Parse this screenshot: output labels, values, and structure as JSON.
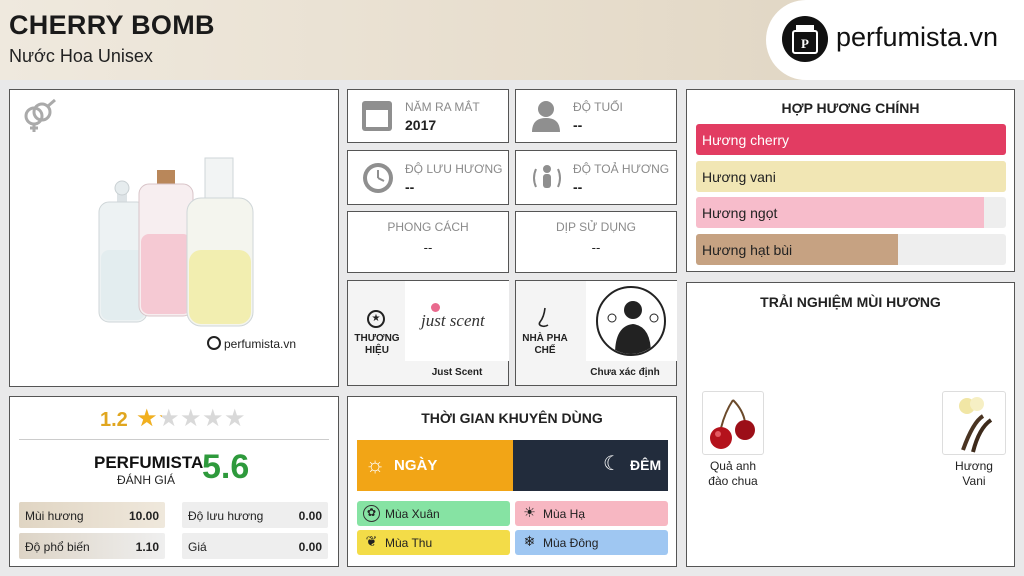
{
  "header": {
    "title": "CHERRY BOMB",
    "subtitle": "Nước Hoa Unisex",
    "logo_text": "perfumista.vn"
  },
  "image_card": {
    "watermark": "perfumista.vn"
  },
  "info": {
    "year_label": "NĂM RA MẮT",
    "year_value": "2017",
    "age_label": "ĐỘ TUỔI",
    "age_value": "--",
    "longevity_label": "ĐỘ LƯU HƯƠNG",
    "longevity_value": "--",
    "sillage_label": "ĐỘ TOẢ HƯƠNG",
    "sillage_value": "--",
    "style_label": "PHONG CÁCH",
    "style_value": "--",
    "occasion_label": "DỊP SỬ DỤNG",
    "occasion_value": "--",
    "brand_label": "THƯƠNG HIỆU",
    "brand_logo_text": "just scent",
    "brand_name": "Just Scent",
    "perfumer_label": "NHÀ PHA CHẾ",
    "perfumer_name": "Chưa xác định"
  },
  "accords": {
    "title": "HỢP HƯƠNG CHÍNH",
    "items": [
      {
        "label": "Hương cherry",
        "level": 1.0,
        "color": "#e23c62",
        "text_color": "#ffffff"
      },
      {
        "label": "Hương vani",
        "level": 1.0,
        "color": "#f1e6b4",
        "text_color": "#222222"
      },
      {
        "label": "Hương ngọt",
        "level": 0.93,
        "color": "#f7bccb",
        "text_color": "#222222"
      },
      {
        "label": "Hương hạt bùi",
        "level": 0.65,
        "color": "#c6a282",
        "text_color": "#222222"
      }
    ]
  },
  "rating": {
    "score": "1.2",
    "stars_filled": 1.2,
    "stars_total": 5,
    "perfumista_label": "PERFUMISTA",
    "perfumista_sub": "ĐÁNH GIÁ",
    "perfumista_score": "5.6",
    "stats": [
      {
        "label": "Mùi hương",
        "value": "10.00"
      },
      {
        "label": "Độ lưu hương",
        "value": "0.00"
      },
      {
        "label": "Độ phổ biến",
        "value": "1.10"
      },
      {
        "label": "Giá",
        "value": "0.00"
      }
    ]
  },
  "time": {
    "title": "THỜI GIAN KHUYÊN DÙNG",
    "day": "NGÀY",
    "night": "ĐÊM",
    "seasons": [
      {
        "label": "Mùa Xuân",
        "color": "#86e3a3"
      },
      {
        "label": "Mùa Hạ",
        "color": "#f7b7c2"
      },
      {
        "label": "Mùa Thu",
        "color": "#f3dc48"
      },
      {
        "label": "Mùa Đông",
        "color": "#9fc7f2"
      }
    ]
  },
  "experience": {
    "title": "TRẢI NGHIỆM MÙI HƯƠNG",
    "notes": [
      {
        "label": "Quả anh đào chua"
      },
      {
        "label": "Hương Vani"
      }
    ]
  }
}
